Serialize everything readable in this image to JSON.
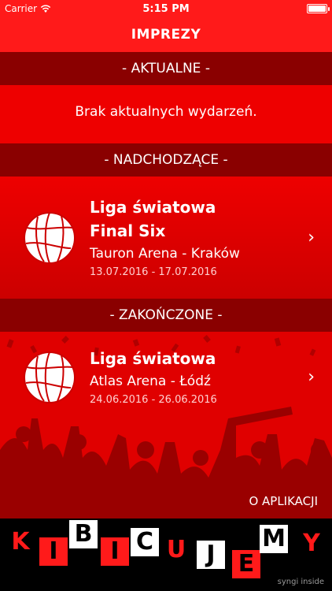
{
  "status_bar": {
    "carrier": "Carrier",
    "time": "5:15 PM"
  },
  "nav": {
    "title": "IMPREZY"
  },
  "sections": {
    "current": {
      "header": "- AKTUALNE -",
      "empty": "Brak aktualnych wydarzeń."
    },
    "upcoming": {
      "header": "- NADCHODZĄCE -"
    },
    "finished": {
      "header": "- ZAKOŃCZONE -"
    }
  },
  "events": [
    {
      "title_line1": "Liga światowa",
      "title_line2": "Final Six",
      "venue": "Tauron Arena - Kraków",
      "dates": "13.07.2016 - 17.07.2016"
    },
    {
      "title_line1": "Liga światowa",
      "venue": "Atlas Arena - Łódź",
      "dates": "24.06.2016 - 26.06.2016"
    }
  ],
  "about": "O APLIKACJI",
  "brand_letters": [
    "K",
    "I",
    "B",
    "I",
    "C",
    "U",
    "J",
    "E",
    "M",
    "Y"
  ],
  "credit": "syngi inside",
  "colors": {
    "accent": "#ff1a1a",
    "header": "#8a0000",
    "footer": "#000000"
  }
}
